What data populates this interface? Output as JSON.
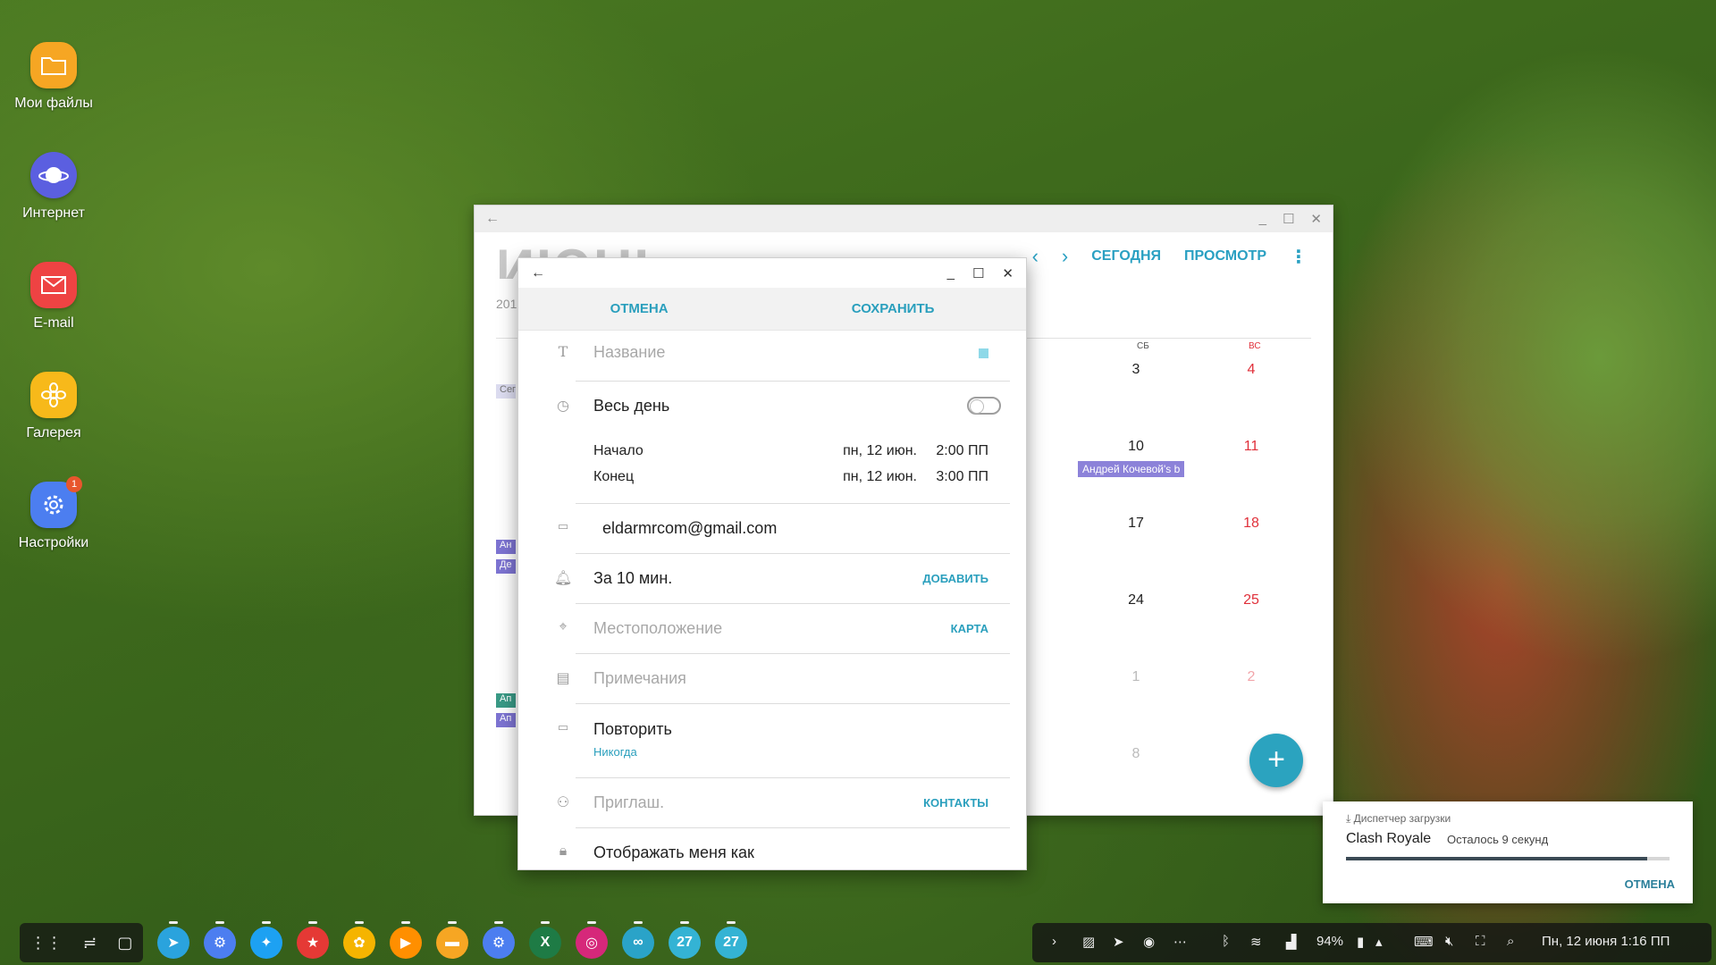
{
  "desktop_icons": [
    {
      "label": "Мои файлы",
      "icon": "folder-icon",
      "color": "#f6a623"
    },
    {
      "label": "Интернет",
      "icon": "planet-icon",
      "color": "#5b5fe0"
    },
    {
      "label": "E-mail",
      "icon": "envelope-icon",
      "color": "#ee4343"
    },
    {
      "label": "Галерея",
      "icon": "flower-icon",
      "color": "#f7b91a"
    },
    {
      "label": "Настройки",
      "icon": "gear-icon",
      "color": "#4c7ef0",
      "badge": "1"
    }
  ],
  "calendar": {
    "month_title": "ИЮНЬ",
    "year": "201",
    "today_label": "СЕГОДНЯ",
    "view_label": "ПРОСМОТР",
    "dow_sat": "СБ",
    "dow_sun": "ВС",
    "days_sat": [
      "3",
      "10",
      "17",
      "24",
      "1",
      "8"
    ],
    "days_sun": [
      "4",
      "11",
      "18",
      "25",
      "2"
    ],
    "event_chip": "Андрей Кочевой's b",
    "left_chips": [
      "Сег",
      "Ан",
      "Де",
      "Ап",
      "Ап"
    ],
    "accent_color": "#2aa0c2"
  },
  "dialog": {
    "cancel_label": "ОТМЕНА",
    "save_label": "СОХРАНИТЬ",
    "title_placeholder": "Название",
    "all_day_label": "Весь день",
    "start_label": "Начало",
    "start_date": "пн, 12 июн.",
    "start_time": "2:00 ПП",
    "end_label": "Конец",
    "end_date": "пн, 12 июн.",
    "end_time": "3:00 ПП",
    "calendar_account": "eldarmrcom@gmail.com",
    "reminder": "За 10 мин.",
    "reminder_action": "ДОБАВИТЬ",
    "location_placeholder": "Местоположение",
    "location_action": "КАРТА",
    "notes_placeholder": "Примечания",
    "repeat_label": "Повторить",
    "repeat_value": "Никогда",
    "invite_placeholder": "Приглаш.",
    "invite_action": "КОНТАКТЫ",
    "show_me_as": "Отображать меня как"
  },
  "notification": {
    "header": "Диспетчер загрузки",
    "title": "Clash Royale",
    "subtitle": "Осталось 9 секунд",
    "progress": 0.93,
    "cancel_label": "ОТМЕНА"
  },
  "taskbar": {
    "apps": [
      {
        "name": "telegram-icon",
        "color": "#2aa3dd",
        "glyph": "➤"
      },
      {
        "name": "settings-icon",
        "color": "#4c7ef0",
        "glyph": "⚙"
      },
      {
        "name": "twitter-icon",
        "color": "#1da1f2",
        "glyph": "✦"
      },
      {
        "name": "bookmark-star-icon",
        "color": "#e53935",
        "glyph": "★"
      },
      {
        "name": "pinwheel-icon",
        "color": "#f5b400",
        "glyph": "✿"
      },
      {
        "name": "play-music-icon",
        "color": "#ff8f00",
        "glyph": "▶"
      },
      {
        "name": "folder-icon",
        "color": "#f6a623",
        "glyph": "▬"
      },
      {
        "name": "settings-icon",
        "color": "#4c7ef0",
        "glyph": "⚙"
      },
      {
        "name": "excel-icon",
        "color": "#1e7b45",
        "glyph": "X"
      },
      {
        "name": "instagram-icon",
        "color": "#d6287a",
        "glyph": "◎"
      },
      {
        "name": "sync-icon",
        "color": "#2aa3c8",
        "glyph": "∞"
      },
      {
        "name": "calendar-27-icon",
        "color": "#34b3d4",
        "glyph": "27"
      },
      {
        "name": "calendar-27-icon",
        "color": "#34b3d4",
        "glyph": "27"
      }
    ],
    "battery": "94%",
    "datetime": "Пн, 12 июня  1:16 ПП"
  }
}
